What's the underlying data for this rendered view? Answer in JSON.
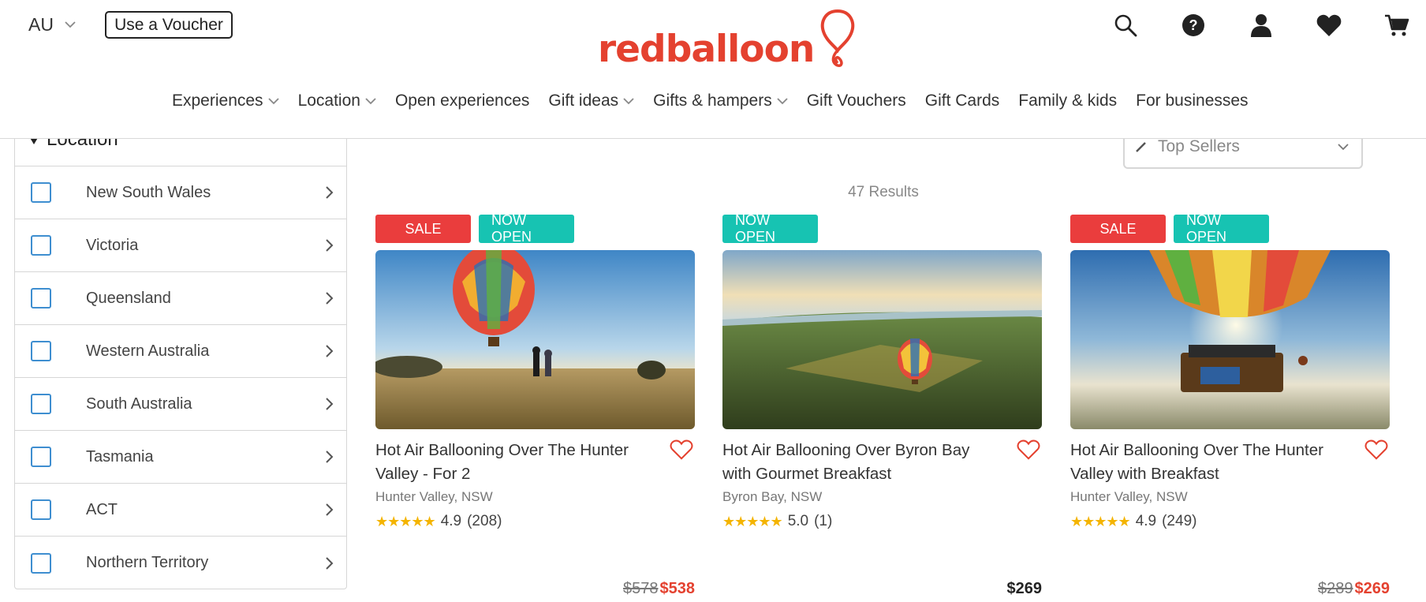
{
  "header": {
    "region": "AU",
    "voucher_button": "Use a Voucher",
    "logo_text": "redballoon",
    "icons": [
      "search-icon",
      "help-icon",
      "account-icon",
      "wishlist-heart-icon",
      "cart-icon"
    ]
  },
  "nav": {
    "items": [
      {
        "label": "Experiences",
        "dropdown": true
      },
      {
        "label": "Location",
        "dropdown": true
      },
      {
        "label": "Open experiences",
        "dropdown": false
      },
      {
        "label": "Gift ideas",
        "dropdown": true
      },
      {
        "label": "Gifts & hampers",
        "dropdown": true
      },
      {
        "label": "Gift Vouchers",
        "dropdown": false
      },
      {
        "label": "Gift Cards",
        "dropdown": false
      },
      {
        "label": "Family & kids",
        "dropdown": false
      },
      {
        "label": "For businesses",
        "dropdown": false
      }
    ]
  },
  "filters": {
    "heading": "Location",
    "items": [
      {
        "label": "New South Wales",
        "checked": false
      },
      {
        "label": "Victoria",
        "checked": false
      },
      {
        "label": "Queensland",
        "checked": false
      },
      {
        "label": "Western Australia",
        "checked": false
      },
      {
        "label": "South Australia",
        "checked": false
      },
      {
        "label": "Tasmania",
        "checked": false
      },
      {
        "label": "ACT",
        "checked": false
      },
      {
        "label": "Northern Territory",
        "checked": false
      }
    ]
  },
  "sort": {
    "selected": "Top Sellers"
  },
  "results": {
    "count_text": "47 Results"
  },
  "products": [
    {
      "badges": [
        "SALE",
        "NOW OPEN"
      ],
      "title": "Hot Air Ballooning Over The Hunter Valley - For 2",
      "location": "Hunter Valley, NSW",
      "stars": "★★★★★",
      "rating": "4.9",
      "reviews": "(208)",
      "price_old": "$578",
      "price_new": "$538"
    },
    {
      "badges": [
        "NOW OPEN"
      ],
      "title": "Hot Air Ballooning Over Byron Bay with Gourmet Breakfast",
      "location": "Byron Bay, NSW",
      "stars": "★★★★★",
      "rating": "5.0",
      "reviews": "(1)",
      "price_old": "",
      "price_new": "$269"
    },
    {
      "badges": [
        "SALE",
        "NOW OPEN"
      ],
      "title": "Hot Air Ballooning Over The Hunter Valley with Breakfast",
      "location": "Hunter Valley, NSW",
      "stars": "★★★★★",
      "rating": "4.9",
      "reviews": "(249)",
      "price_old": "$289",
      "price_new": "$269"
    }
  ],
  "colors": {
    "brand_red": "#e4412f",
    "sale_badge": "#ea3d3d",
    "open_badge": "#17c3b2",
    "checkbox_blue": "#3e8ed0",
    "star_gold": "#f4b400"
  }
}
